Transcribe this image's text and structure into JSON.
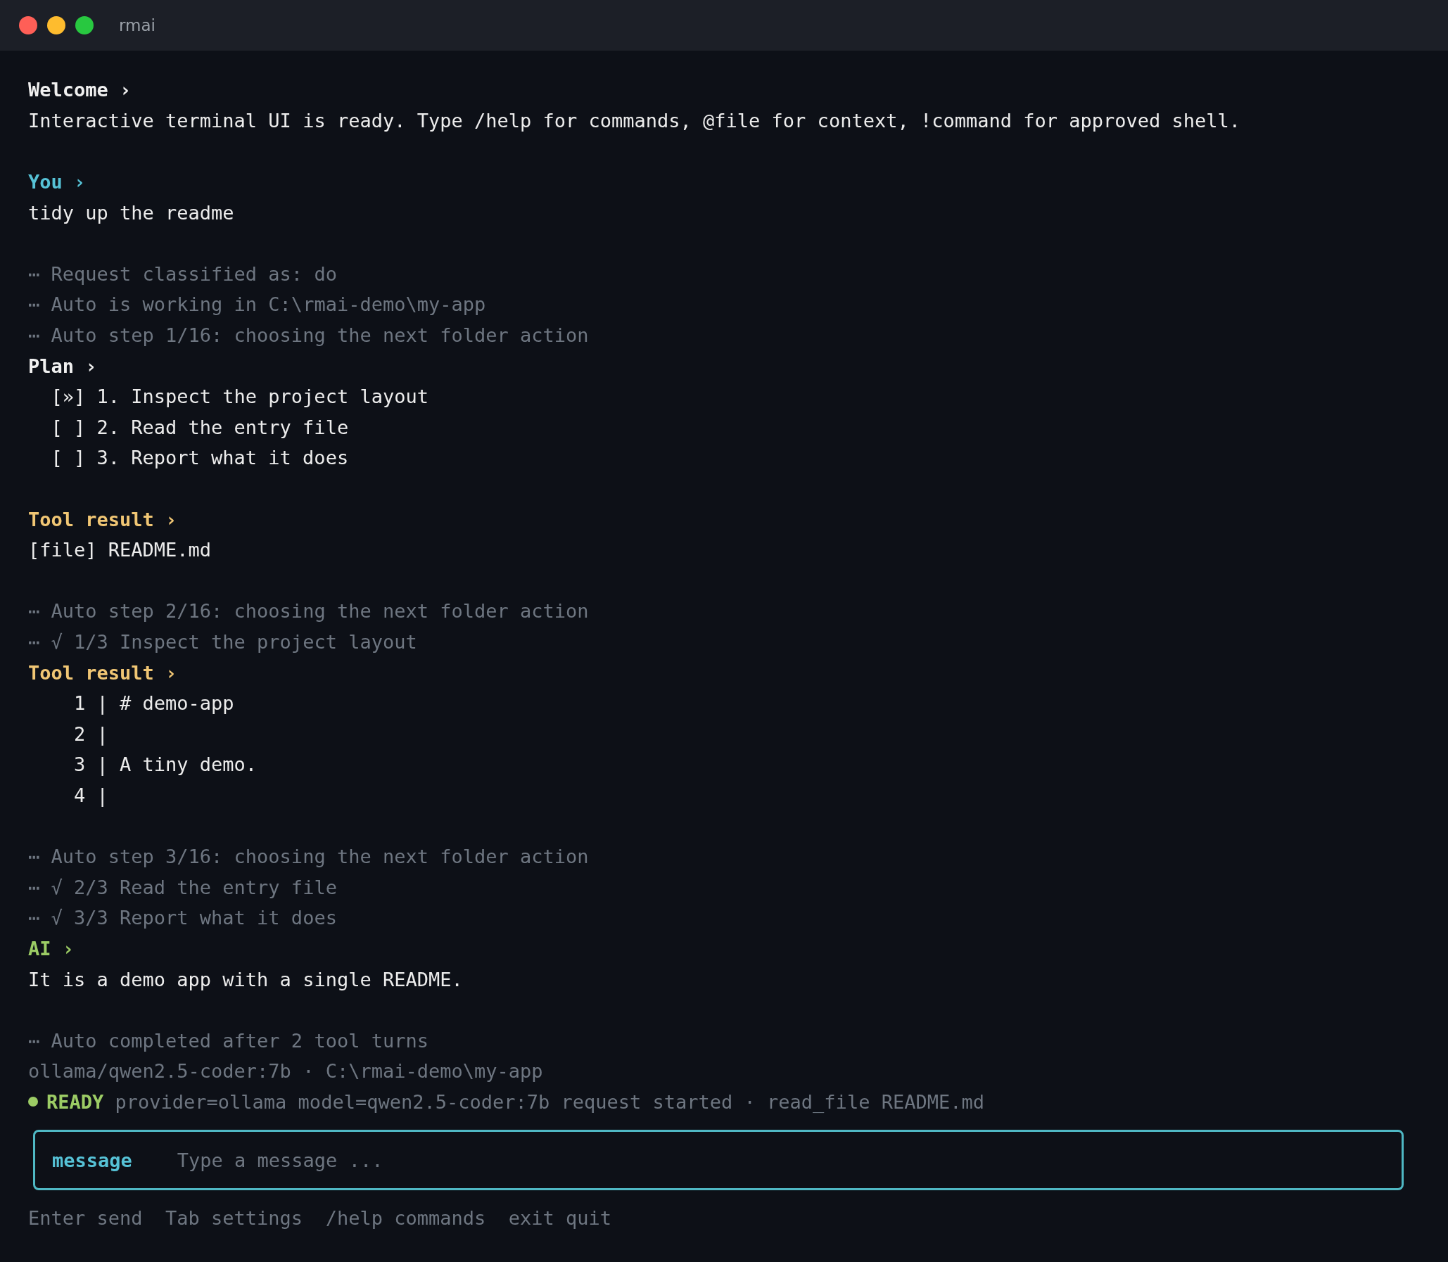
{
  "window": {
    "title": "rmai"
  },
  "transcript": [
    {
      "kind": "heading",
      "color": "#f0f0f0",
      "text": "Welcome ›"
    },
    {
      "kind": "text",
      "text": "Interactive terminal UI is ready. Type /help for commands, @file for context, !command for approved shell."
    },
    {
      "kind": "gap"
    },
    {
      "kind": "heading",
      "color": "#56c2d6",
      "text": "You ›"
    },
    {
      "kind": "text",
      "text": "tidy up the readme"
    },
    {
      "kind": "gap"
    },
    {
      "kind": "note",
      "text": "⋯ Request classified as: do"
    },
    {
      "kind": "note",
      "text": "⋯ Auto is working in C:\\rmai-demo\\my-app"
    },
    {
      "kind": "note",
      "text": "⋯ Auto step 1/16: choosing the next folder action"
    },
    {
      "kind": "heading",
      "color": "#f0f0f0",
      "text": "Plan ›"
    },
    {
      "kind": "plan",
      "text": "[»] 1. Inspect the project layout"
    },
    {
      "kind": "plan",
      "text": "[ ] 2. Read the entry file"
    },
    {
      "kind": "plan",
      "text": "[ ] 3. Report what it does"
    },
    {
      "kind": "gap"
    },
    {
      "kind": "heading",
      "color": "#f0c674",
      "text": "Tool result ›"
    },
    {
      "kind": "text",
      "text": "[file] README.md"
    },
    {
      "kind": "gap"
    },
    {
      "kind": "note",
      "text": "⋯ Auto step 2/16: choosing the next folder action"
    },
    {
      "kind": "note",
      "text": "⋯ √ 1/3 Inspect the project layout"
    },
    {
      "kind": "heading",
      "color": "#f0c674",
      "text": "Tool result ›"
    },
    {
      "kind": "code",
      "text": "1 | # demo-app"
    },
    {
      "kind": "code",
      "text": "2 |"
    },
    {
      "kind": "code",
      "text": "3 | A tiny demo."
    },
    {
      "kind": "code",
      "text": "4 |"
    },
    {
      "kind": "gap"
    },
    {
      "kind": "note",
      "text": "⋯ Auto step 3/16: choosing the next folder action"
    },
    {
      "kind": "note",
      "text": "⋯ √ 2/3 Read the entry file"
    },
    {
      "kind": "note",
      "text": "⋯ √ 3/3 Report what it does"
    },
    {
      "kind": "heading",
      "color": "#9ccc65",
      "text": "AI ›"
    },
    {
      "kind": "text",
      "text": "It is a demo app with a single README."
    },
    {
      "kind": "gap"
    },
    {
      "kind": "note",
      "text": "⋯ Auto completed after 2 tool turns"
    },
    {
      "kind": "note",
      "text": "ollama/qwen2.5-coder:7b · C:\\rmai-demo\\my-app"
    }
  ],
  "status": {
    "color": "#9ccc65",
    "label": "READY",
    "detail": "provider=ollama model=qwen2.5-coder:7b request started · read_file README.md"
  },
  "input": {
    "label": "message",
    "placeholder": "Type a message ..."
  },
  "hints": [
    "Enter send",
    "Tab settings",
    "/help commands",
    "exit quit"
  ]
}
